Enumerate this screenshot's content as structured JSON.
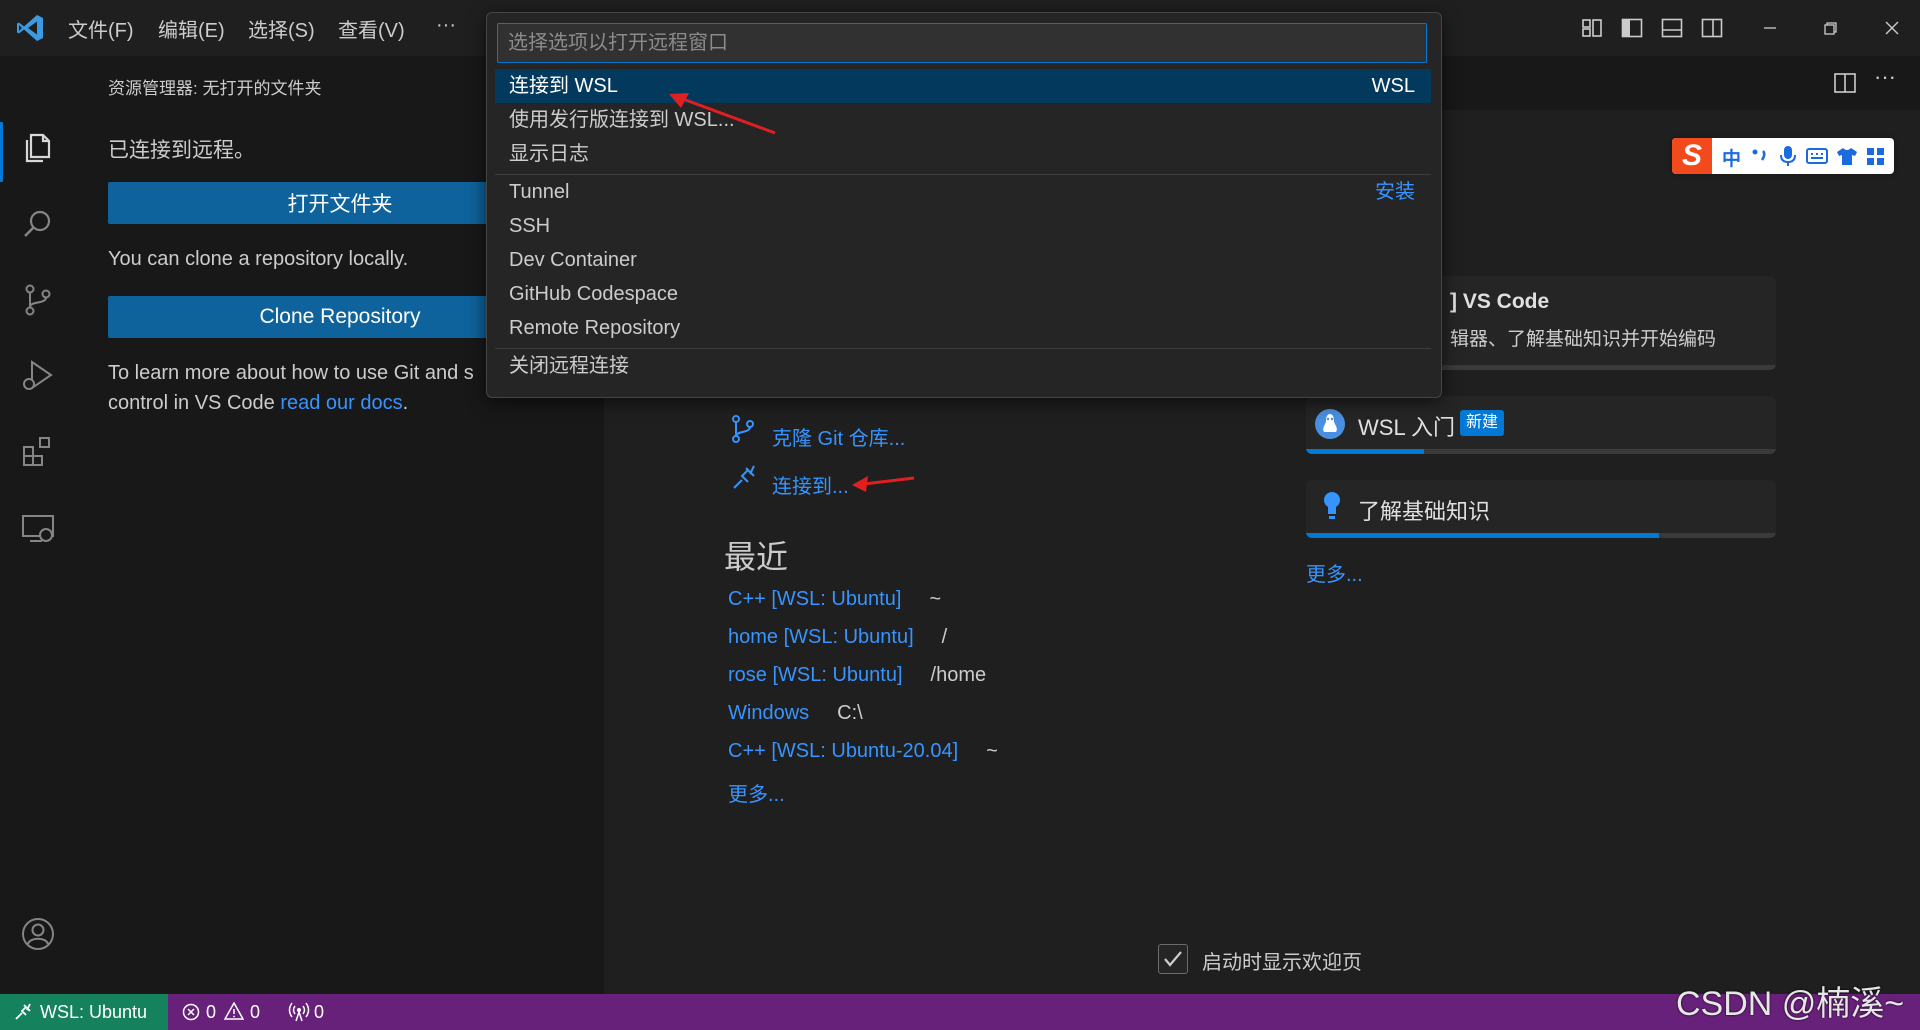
{
  "menu": {
    "items": [
      "文件(F)",
      "编辑(E)",
      "选择(S)",
      "查看(V)"
    ],
    "more": "···"
  },
  "quickpick": {
    "placeholder": "选择选项以打开远程窗口",
    "items": [
      {
        "label": "连接到 WSL",
        "right": "WSL"
      },
      {
        "label": "使用发行版连接到 WSL...",
        "right": ""
      },
      {
        "label": "显示日志",
        "right": ""
      },
      {
        "label": "Tunnel",
        "right": "安装"
      },
      {
        "label": "SSH",
        "right": ""
      },
      {
        "label": "Dev Container",
        "right": ""
      },
      {
        "label": "GitHub Codespace",
        "right": ""
      },
      {
        "label": "Remote Repository",
        "right": ""
      },
      {
        "label": "关闭远程连接",
        "right": ""
      }
    ]
  },
  "sidebar": {
    "title": "资源管理器: 无打开的文件夹",
    "connected": "已连接到远程。",
    "open_folder": "打开文件夹",
    "clone_text": "You can clone a repository locally.",
    "clone_button": "Clone Repository",
    "learn_text_1": "To learn more about how to use Git and s",
    "learn_text_2": "control in VS Code",
    "learn_link": "read our docs",
    "learn_end": "."
  },
  "welcome": {
    "start_clone": "克隆 Git 仓库...",
    "start_connect": "连接到...",
    "recent_heading": "最近",
    "recent": [
      {
        "name": "C++ [WSL: Ubuntu]",
        "path": "~"
      },
      {
        "name": "home [WSL: Ubuntu]",
        "path": "/"
      },
      {
        "name": "rose [WSL: Ubuntu]",
        "path": "/home"
      },
      {
        "name": "Windows",
        "path": "C:\\"
      },
      {
        "name": "C++ [WSL: Ubuntu-20.04]",
        "path": "~"
      }
    ],
    "recent_more": "更多...",
    "walkthroughs": {
      "card1_title": "] VS Code",
      "card1_desc": "辑器、了解基础知识并开始编码",
      "card1_progress": 0.06,
      "card2_title": "WSL 入门",
      "card2_badge": "新建",
      "card2_progress": 0.25,
      "card3_title": "了解基础知识",
      "card3_progress": 0.75,
      "more": "更多..."
    },
    "show_on_startup": "启动时显示欢迎页",
    "show_on_startup_checked": true
  },
  "ime": {
    "logo": "S",
    "label": "中"
  },
  "statusbar": {
    "remote": "WSL: Ubuntu",
    "errors": "0",
    "warnings": "0",
    "ports": "0"
  },
  "watermark": "CSDN @楠溪~",
  "colors": {
    "accent": "#0078d4",
    "status_bar": "#68217a",
    "remote_indicator": "#16825d",
    "link": "#3794ff"
  }
}
